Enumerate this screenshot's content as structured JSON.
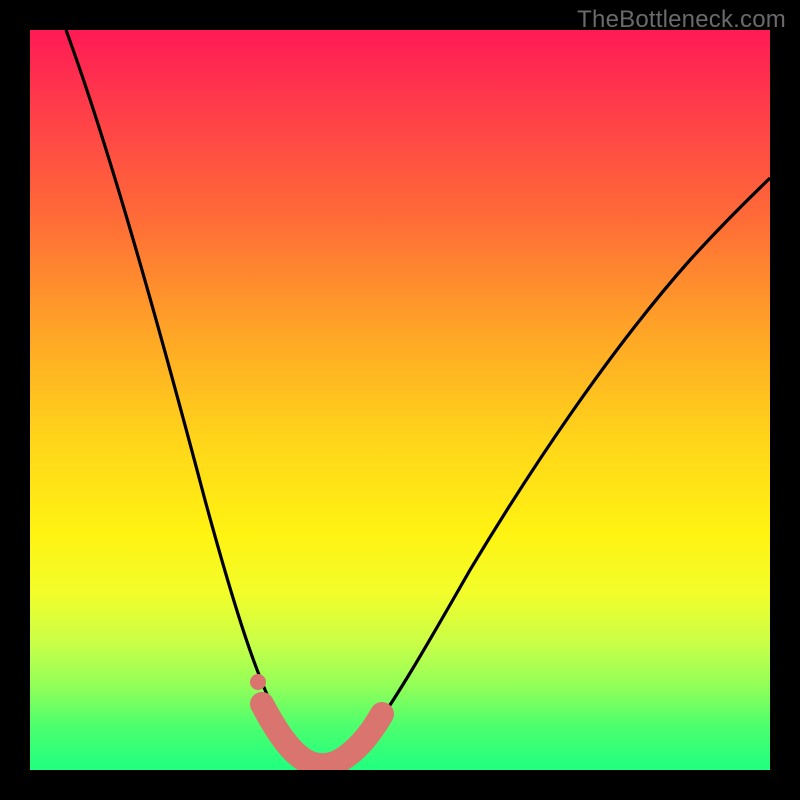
{
  "watermark": "TheBottleneck.com",
  "chart_data": {
    "type": "line",
    "title": "",
    "xlabel": "",
    "ylabel": "",
    "xlim": [
      0,
      100
    ],
    "ylim": [
      0,
      100
    ],
    "series": [
      {
        "name": "bottleneck-curve",
        "x": [
          5,
          10,
          15,
          20,
          25,
          28,
          31,
          33,
          35,
          37,
          39,
          41,
          43,
          46,
          50,
          55,
          60,
          66,
          73,
          80,
          88,
          96,
          100
        ],
        "values": [
          100,
          84,
          68,
          52,
          36,
          24,
          14,
          8,
          4,
          2,
          1,
          1,
          2,
          4,
          8,
          14,
          21,
          30,
          40,
          49,
          58,
          66,
          70
        ]
      }
    ],
    "annotations": [
      {
        "name": "bottom-highlight",
        "x_range": [
          32,
          44
        ],
        "y": 2
      }
    ],
    "gradient_colors": {
      "top": "#ff1a55",
      "mid_high": "#ffa227",
      "mid": "#fff312",
      "mid_low": "#c8ff48",
      "bottom": "#1fff80"
    }
  }
}
